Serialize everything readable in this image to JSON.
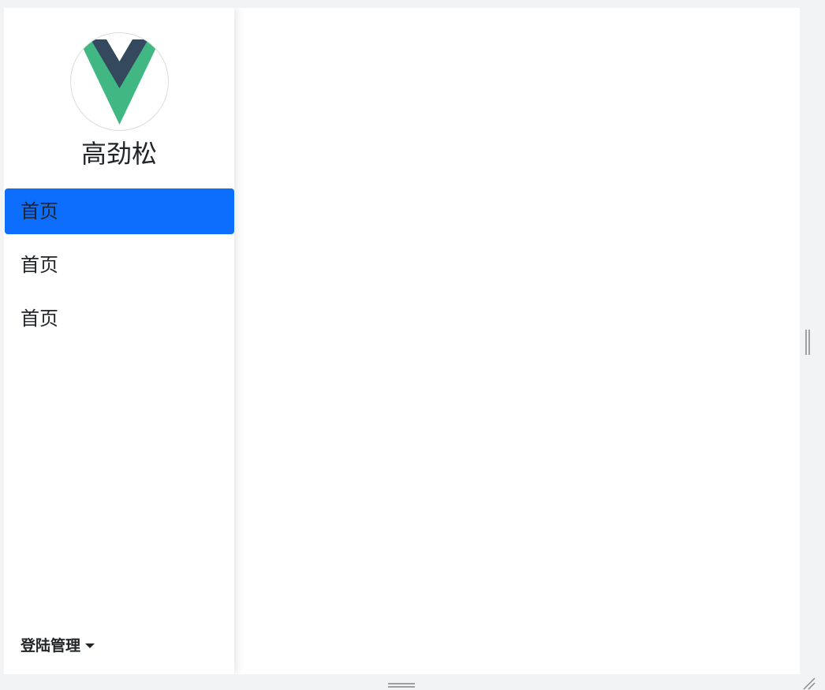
{
  "user": {
    "avatar_icon": "vue-logo-icon",
    "name": "高劲松"
  },
  "nav": {
    "items": [
      {
        "label": "首页",
        "active": true
      },
      {
        "label": "首页",
        "active": false
      },
      {
        "label": "首页",
        "active": false
      }
    ]
  },
  "footer": {
    "login_menu_label": "登陆管理",
    "login_menu_icon": "caret-down-icon"
  },
  "colors": {
    "accent": "#0d6efd",
    "vue_green": "#41b883",
    "vue_dark": "#34495e",
    "page_bg": "#f2f3f5"
  },
  "window_controls": {
    "vertical_splitter_icon": "drag-handle-vertical-icon",
    "horizontal_splitter_icon": "drag-handle-horizontal-icon",
    "resize_icon": "resize-corner-icon"
  }
}
